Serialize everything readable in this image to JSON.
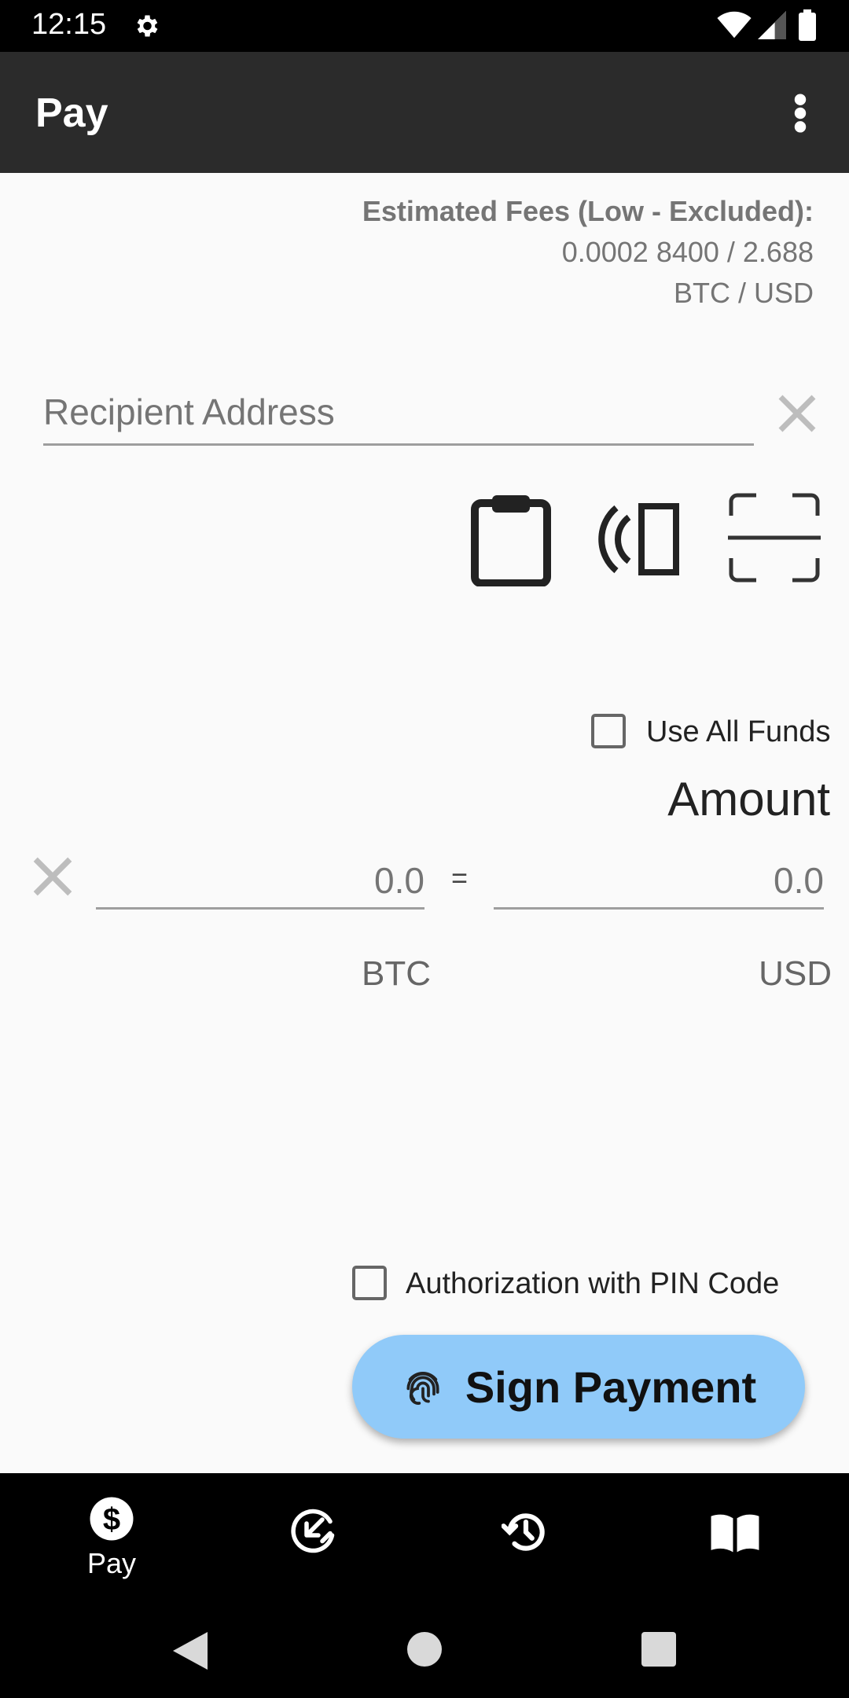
{
  "status_bar": {
    "time": "12:15"
  },
  "app_bar": {
    "title": "Pay"
  },
  "fees": {
    "title": "Estimated Fees (Low - Excluded):",
    "values": "0.0002 8400 / 2.688",
    "units": "BTC / USD"
  },
  "recipient": {
    "placeholder": "Recipient Address"
  },
  "use_all_funds": {
    "label": "Use All Funds",
    "checked": false
  },
  "amount": {
    "title": "Amount",
    "btc_placeholder": "0.0",
    "usd_placeholder": "0.0",
    "equals": "=",
    "btc_unit": "BTC",
    "usd_unit": "USD"
  },
  "pin_auth": {
    "label": "Authorization with PIN Code",
    "checked": false
  },
  "sign_button": {
    "label": "Sign Payment"
  },
  "bottom_nav": {
    "items": [
      {
        "label": "Pay",
        "icon": "dollar-circle-icon",
        "active": true
      },
      {
        "label": "",
        "icon": "receive-icon",
        "active": false
      },
      {
        "label": "",
        "icon": "history-icon",
        "active": false
      },
      {
        "label": "",
        "icon": "book-icon",
        "active": false
      }
    ]
  },
  "colors": {
    "accent": "#90caf9",
    "app_bar": "#2b2b2b",
    "background": "#fafafa"
  }
}
